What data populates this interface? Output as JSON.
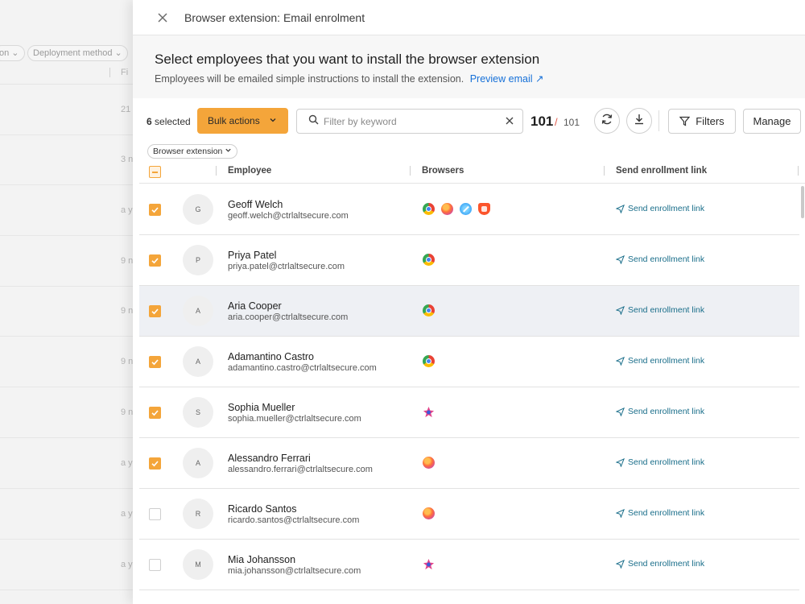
{
  "background": {
    "filter_chip_partial": "on",
    "deployment_chip": "Deployment method",
    "column_partial": "Fi",
    "row_snippets": [
      "21",
      "3 n",
      "a y",
      "9 n",
      "9 n",
      "9 n",
      "9 n",
      "a y",
      "a y",
      "a y"
    ]
  },
  "drawer": {
    "title": "Browser extension: Email enrolment",
    "heading": "Select employees that you want to install the browser extension",
    "subtext": "Employees will be emailed simple instructions to install the extension.",
    "preview_link": "Preview email ↗"
  },
  "toolbar": {
    "selected_count": "6",
    "selected_label": "selected",
    "bulk_actions_label": "Bulk actions",
    "search_placeholder": "Filter by keyword",
    "shown_count": "101",
    "slash": "/",
    "total_count": "101",
    "filters_label": "Filters",
    "manage_label": "Manage"
  },
  "filter_chip": {
    "label": "Browser extension"
  },
  "table": {
    "columns": [
      "Employee",
      "Browsers",
      "Send enrollment link"
    ],
    "rows": [
      {
        "initial": "G",
        "name": "Geoff Welch",
        "email": "geoff.welch@ctrlaltsecure.com",
        "checked": true,
        "browsers": [
          "chrome",
          "firefox",
          "safari",
          "brave"
        ],
        "action": "Send enrollment link"
      },
      {
        "initial": "P",
        "name": "Priya Patel",
        "email": "priya.patel@ctrlaltsecure.com",
        "checked": true,
        "browsers": [
          "chrome"
        ],
        "action": "Send enrollment link"
      },
      {
        "initial": "A",
        "name": "Aria Cooper",
        "email": "aria.cooper@ctrlaltsecure.com",
        "checked": true,
        "browsers": [
          "chrome"
        ],
        "action": "Send enrollment link",
        "highlighted": true
      },
      {
        "initial": "A",
        "name": "Adamantino Castro",
        "email": "adamantino.castro@ctrlaltsecure.com",
        "checked": true,
        "browsers": [
          "chrome"
        ],
        "action": "Send enrollment link"
      },
      {
        "initial": "S",
        "name": "Sophia Mueller",
        "email": "sophia.mueller@ctrlaltsecure.com",
        "checked": true,
        "browsers": [
          "arc"
        ],
        "action": "Send enrollment link"
      },
      {
        "initial": "A",
        "name": "Alessandro Ferrari",
        "email": "alessandro.ferrari@ctrlaltsecure.com",
        "checked": true,
        "browsers": [
          "firefox"
        ],
        "action": "Send enrollment link"
      },
      {
        "initial": "R",
        "name": "Ricardo Santos",
        "email": "ricardo.santos@ctrlaltsecure.com",
        "checked": false,
        "browsers": [
          "firefox"
        ],
        "action": "Send enrollment link"
      },
      {
        "initial": "M",
        "name": "Mia Johansson",
        "email": "mia.johansson@ctrlaltsecure.com",
        "checked": false,
        "browsers": [
          "arc"
        ],
        "action": "Send enrollment link"
      }
    ]
  },
  "colors": {
    "accent": "#f4a53a",
    "link": "#1670d8",
    "send_link": "#1a6e8a",
    "count_slash": "#e25b4b"
  }
}
